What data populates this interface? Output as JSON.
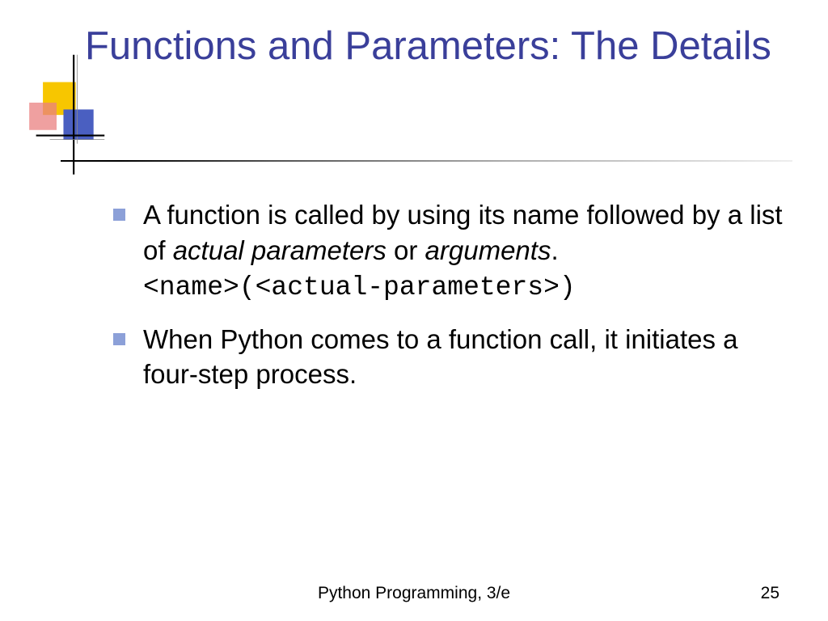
{
  "title": "Functions and Parameters: The Details",
  "bullets": [
    {
      "pre": "A function is called by using its name followed by a list of ",
      "em1": "actual parameters",
      "mid": " or ",
      "em2": "arguments",
      "post": ".",
      "code": "<name>(<actual-parameters>)"
    },
    {
      "text": "When Python comes to a function call, it initiates a four-step process."
    }
  ],
  "footer": {
    "center": "Python Programming, 3/e",
    "page": "25"
  }
}
